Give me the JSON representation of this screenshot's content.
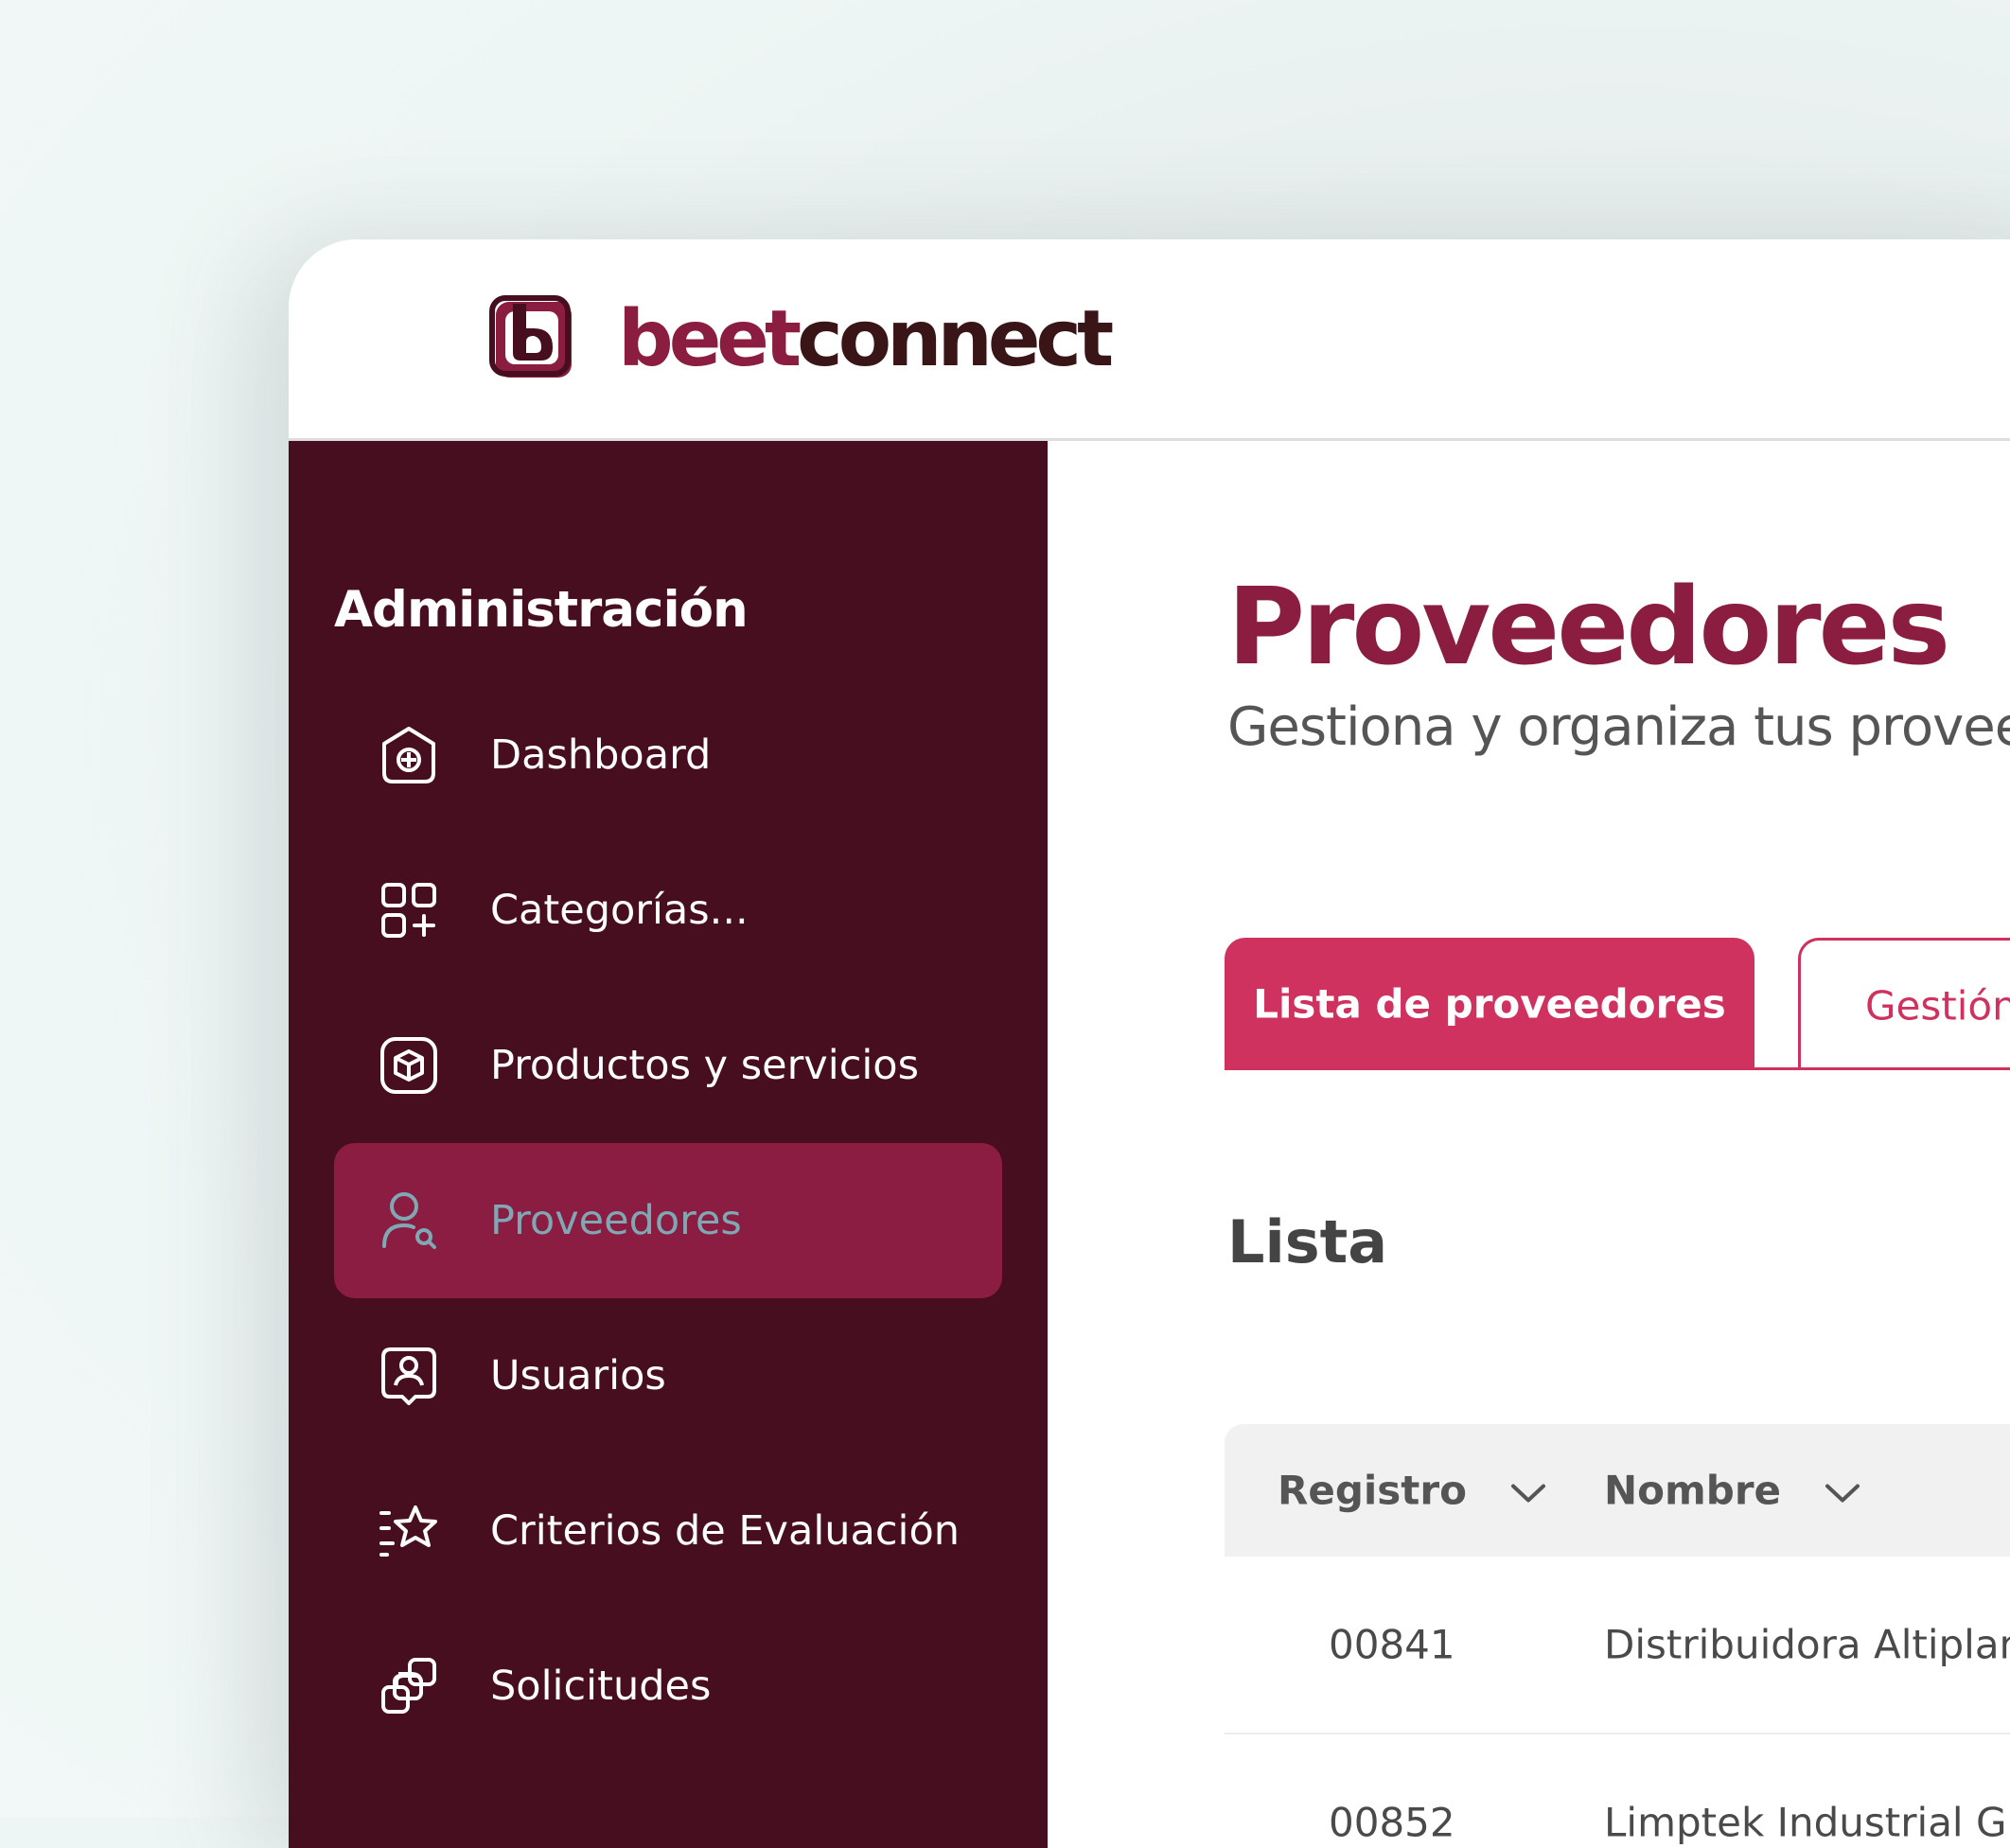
{
  "brand": {
    "part1": "beet",
    "part2": "connect"
  },
  "sidebar": {
    "title": "Administración",
    "items": [
      {
        "label": "Dashboard",
        "icon": "dashboard-home-icon"
      },
      {
        "label": "Categorías...",
        "icon": "categories-grid-icon"
      },
      {
        "label": "Productos y servicios",
        "icon": "box-icon"
      },
      {
        "label": "Proveedores",
        "icon": "user-search-icon",
        "active": true
      },
      {
        "label": "Usuarios",
        "icon": "user-badge-icon"
      },
      {
        "label": "Criterios de Evaluación",
        "icon": "star-list-icon"
      },
      {
        "label": "Solicitudes",
        "icon": "stacked-squares-icon"
      }
    ]
  },
  "main": {
    "title": "Proveedores",
    "subtitle": "Gestiona y organiza tus proveedor",
    "tabs": [
      {
        "label": "Lista de proveedores",
        "active": true
      },
      {
        "label": "Gestión",
        "active": false
      }
    ],
    "section_title": "Lista",
    "table": {
      "headers": [
        "Registro",
        "Nombre"
      ],
      "rows": [
        [
          "00841",
          "Distribuidora Altiplanc"
        ],
        [
          "00852",
          "Limptek Industrial Gua"
        ]
      ]
    }
  },
  "colors": {
    "brand_dark": "#470e20",
    "brand_accent": "#8b1d41",
    "tab_primary": "#cf325f",
    "active_label": "#7fa8b4"
  }
}
